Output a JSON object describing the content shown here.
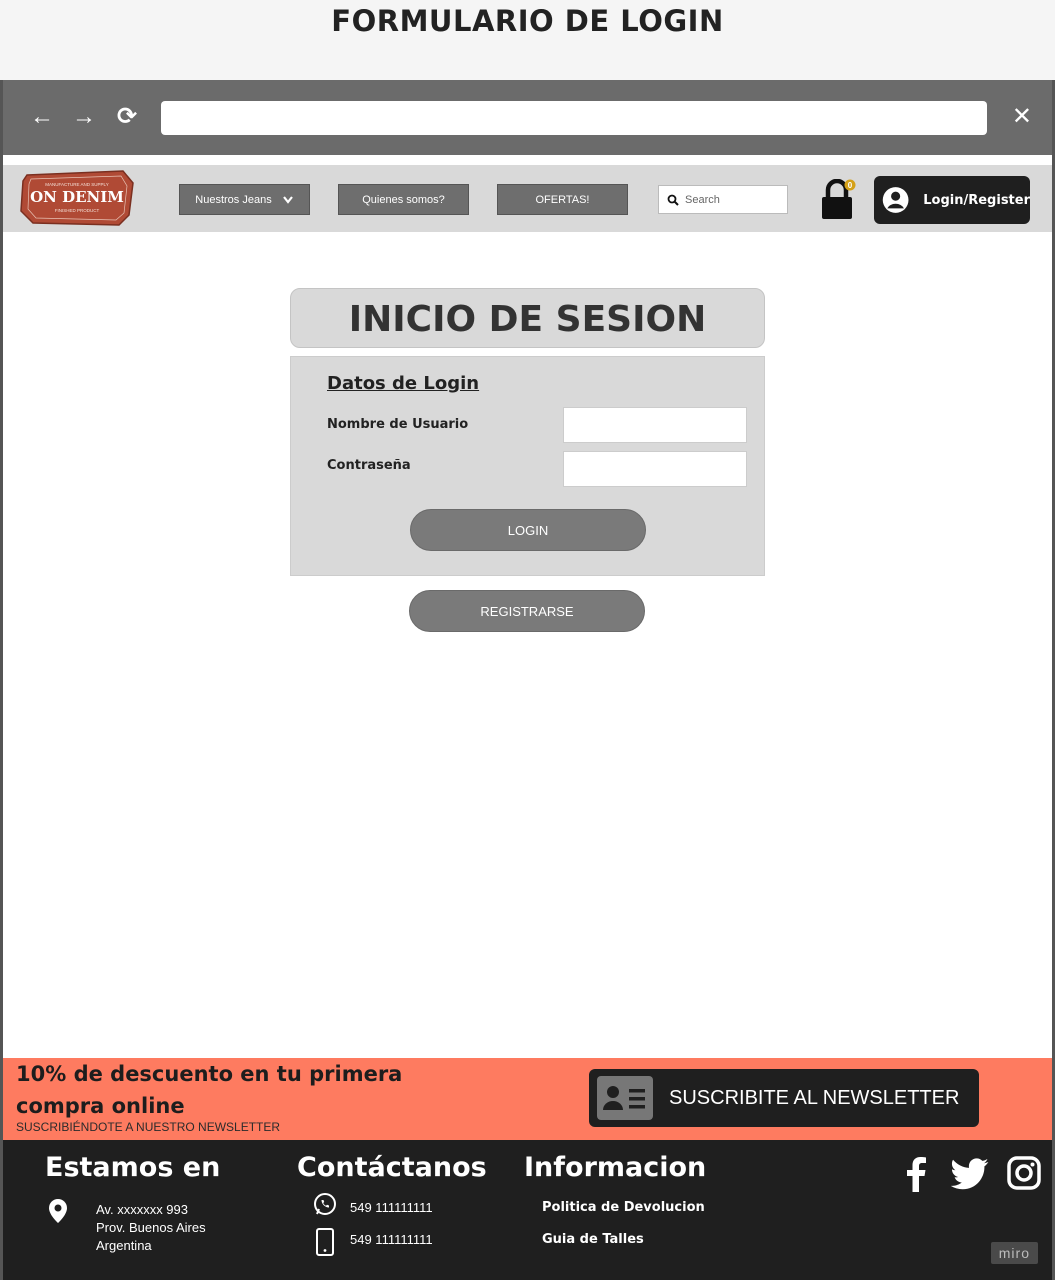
{
  "page": {
    "title": "FORMULARIO DE LOGIN"
  },
  "browser": {
    "back_icon": "arrow-left-icon",
    "forward_icon": "arrow-right-icon",
    "reload_icon": "reload-icon",
    "close_icon": "close-icon",
    "back_glyph": "←",
    "forward_glyph": "→",
    "reload_glyph": "⟳",
    "close_glyph": "✕",
    "url_value": ""
  },
  "header": {
    "logo": {
      "top_text": "MANUFACTURE AND SUPPLY",
      "main_text": "ON DENIM",
      "bottom_text": "FINISHED PRODUCT"
    },
    "nav": [
      {
        "label": "Nuestros Jeans",
        "has_dropdown": true
      },
      {
        "label": "Quienes somos?"
      },
      {
        "label": "OFERTAS!"
      }
    ],
    "search_placeholder": "Search",
    "cart_count": "0",
    "login_register_label": "Login/Register"
  },
  "login": {
    "title": "INICIO DE SESION",
    "section_heading": "Datos de Login",
    "username_label": "Nombre de Usuario",
    "password_label": "Contraseña",
    "username_value": "",
    "password_value": "",
    "login_button": "LOGIN",
    "register_button": "REGISTRARSE"
  },
  "promo": {
    "headline": "10% de descuento en tu primera compra online",
    "subtext": "SUSCRIBIÉNDOTE A NUESTRO NEWSLETTER",
    "newsletter_button": "SUSCRIBITE AL NEWSLETTER"
  },
  "footer": {
    "location": {
      "title": "Estamos en",
      "line1": "Av. xxxxxxx 993",
      "line2": "Prov. Buenos Aires",
      "line3": "Argentina"
    },
    "contact": {
      "title": "Contáctanos",
      "whatsapp": "549 111111111",
      "phone": "549 111111111"
    },
    "info": {
      "title": "Informacion",
      "link1": "Politica de Devolucion",
      "link2": "Guia de Talles"
    },
    "social_icons": [
      "facebook-icon",
      "twitter-icon",
      "instagram-icon"
    ],
    "watermark": "miro"
  },
  "colors": {
    "accent": "#fe7b60",
    "dark": "#1f1f1f",
    "chrome": "#6b6b6b",
    "nav_button": "#6e6e6e",
    "panel": "#d9d9d9",
    "logo_red": "#b04a35",
    "cart_badge": "#d4a017"
  }
}
